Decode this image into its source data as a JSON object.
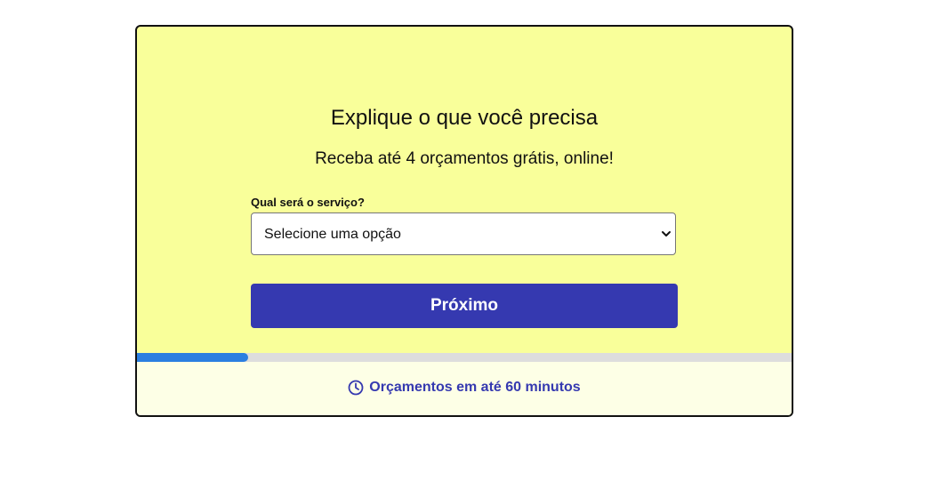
{
  "form": {
    "title": "Explique o que você precisa",
    "subtitle": "Receba até 4 orçamentos grátis, online!",
    "service_label": "Qual será o serviço?",
    "service_select": {
      "selected": "Selecione uma opção",
      "icon": "chevron-down-icon"
    },
    "next_label": "Próximo"
  },
  "progress": {
    "fraction": 0.17,
    "fill_color": "#2b7fe0",
    "track_color": "#dddddd"
  },
  "footer": {
    "icon": "clock-icon",
    "text": "Orçamentos em até 60 minutos"
  },
  "colors": {
    "card_background": "#f9ff9a",
    "footer_background": "#fdffe6",
    "accent": "#3539b0"
  }
}
